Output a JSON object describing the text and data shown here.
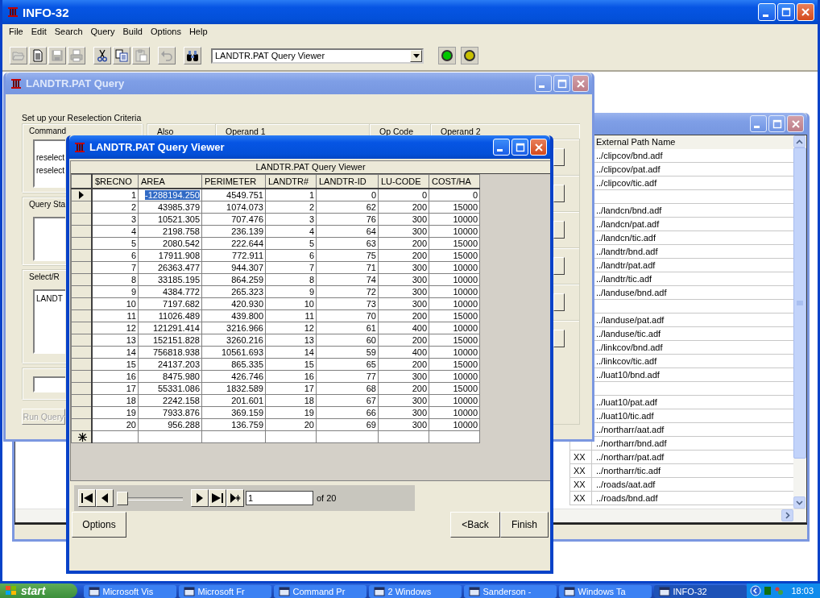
{
  "app_window": {
    "title": "INFO-32",
    "menu": [
      "File",
      "Edit",
      "Search",
      "Query",
      "Build",
      "Options",
      "Help"
    ],
    "toolbar": {
      "groups": [
        [
          {
            "kind": "open",
            "disabled": true
          },
          {
            "kind": "new",
            "disabled": false
          },
          {
            "kind": "save",
            "disabled": true
          },
          {
            "kind": "print",
            "disabled": true
          }
        ],
        [
          {
            "kind": "cut",
            "disabled": false
          },
          {
            "kind": "copy",
            "disabled": false
          },
          {
            "kind": "paste",
            "disabled": true
          }
        ],
        [
          {
            "kind": "undo",
            "disabled": true
          }
        ],
        [
          {
            "kind": "find",
            "disabled": false
          }
        ]
      ],
      "window_list": {
        "value": "LANDTR.PAT Query Viewer"
      },
      "lights": [
        {
          "color": "#00c800"
        },
        {
          "color": "#c8c000"
        }
      ]
    }
  },
  "files_window": {
    "column": "External Path Name",
    "rows": [
      {
        "kind": "file",
        "path": "../clipcov/bnd.adf"
      },
      {
        "kind": "file",
        "path": "../clipcov/pat.adf"
      },
      {
        "kind": "file",
        "path": "../clipcov/tic.adf"
      },
      {
        "kind": "blank"
      },
      {
        "kind": "file",
        "path": "../landcn/bnd.adf"
      },
      {
        "kind": "file",
        "path": "../landcn/pat.adf"
      },
      {
        "kind": "file",
        "path": "../landcn/tic.adf"
      },
      {
        "kind": "file",
        "path": "../landtr/bnd.adf"
      },
      {
        "kind": "file",
        "path": "../landtr/pat.adf"
      },
      {
        "kind": "file",
        "path": "../landtr/tic.adf"
      },
      {
        "kind": "file",
        "path": "../landuse/bnd.adf"
      },
      {
        "kind": "blank"
      },
      {
        "kind": "file",
        "path": "../landuse/pat.adf"
      },
      {
        "kind": "file",
        "path": "../landuse/tic.adf"
      },
      {
        "kind": "file",
        "path": "../linkcov/bnd.adf"
      },
      {
        "kind": "file",
        "path": "../linkcov/tic.adf"
      },
      {
        "kind": "file",
        "path": "../luat10/bnd.adf"
      },
      {
        "kind": "blank"
      },
      {
        "kind": "file",
        "path": "../luat10/pat.adf"
      },
      {
        "kind": "file",
        "path": "../luat10/tic.adf"
      },
      {
        "kind": "file",
        "path": "../northarr/aat.adf"
      },
      {
        "kind": "file",
        "path": "../northarr/bnd.adf"
      },
      {
        "kind": "file",
        "flag": "XX",
        "path": "../northarr/pat.adf"
      },
      {
        "kind": "file",
        "flag": "XX",
        "path": "../northarr/tic.adf"
      },
      {
        "kind": "file",
        "flag": "XX",
        "path": "../roads/aat.adf"
      },
      {
        "kind": "file",
        "flag": "XX",
        "path": "../roads/bnd.adf"
      }
    ]
  },
  "query_window": {
    "title": "LANDTR.PAT Query",
    "instructions": "Set up your Reselection Criteria",
    "command": {
      "label": "Command",
      "lines": [
        "reselect",
        "reselect"
      ]
    },
    "query_status": {
      "label": "Query Sta"
    },
    "select": {
      "label": "Select/R",
      "items": [
        "LANDT"
      ]
    },
    "run_button": {
      "label": "Run Query",
      "disabled": true
    },
    "criteria_columns": [
      "Also",
      "Operand 1",
      "Op Code",
      "Operand 2"
    ]
  },
  "viewer_window": {
    "title": "LANDTR.PAT Query Viewer",
    "grid": {
      "caption": "LANDTR.PAT Query Viewer",
      "columns": [
        "$RECNO",
        "AREA",
        "PERIMETER",
        "LANDTR#",
        "LANDTR-ID",
        "LU-CODE",
        "COST/HA"
      ],
      "rows": [
        {
          "current": true,
          "cells": [
            {
              "text": "1",
              "selected": false
            },
            {
              "text": "-1288194.250",
              "selected": true
            },
            {
              "text": "4549.751",
              "selected": false
            },
            {
              "text": "1",
              "selected": false
            },
            {
              "text": "0",
              "selected": false
            },
            {
              "text": "0",
              "selected": false
            },
            {
              "text": "0",
              "selected": false
            }
          ]
        },
        {
          "current": false,
          "cells": [
            {
              "text": "2",
              "selected": false
            },
            {
              "text": "43985.379",
              "selected": false
            },
            {
              "text": "1074.073",
              "selected": false
            },
            {
              "text": "2",
              "selected": false
            },
            {
              "text": "62",
              "selected": false
            },
            {
              "text": "200",
              "selected": false
            },
            {
              "text": "15000",
              "selected": false
            }
          ]
        },
        {
          "current": false,
          "cells": [
            {
              "text": "3",
              "selected": false
            },
            {
              "text": "10521.305",
              "selected": false
            },
            {
              "text": "707.476",
              "selected": false
            },
            {
              "text": "3",
              "selected": false
            },
            {
              "text": "76",
              "selected": false
            },
            {
              "text": "300",
              "selected": false
            },
            {
              "text": "10000",
              "selected": false
            }
          ]
        },
        {
          "current": false,
          "cells": [
            {
              "text": "4",
              "selected": false
            },
            {
              "text": "2198.758",
              "selected": false
            },
            {
              "text": "236.139",
              "selected": false
            },
            {
              "text": "4",
              "selected": false
            },
            {
              "text": "64",
              "selected": false
            },
            {
              "text": "300",
              "selected": false
            },
            {
              "text": "10000",
              "selected": false
            }
          ]
        },
        {
          "current": false,
          "cells": [
            {
              "text": "5",
              "selected": false
            },
            {
              "text": "2080.542",
              "selected": false
            },
            {
              "text": "222.644",
              "selected": false
            },
            {
              "text": "5",
              "selected": false
            },
            {
              "text": "63",
              "selected": false
            },
            {
              "text": "200",
              "selected": false
            },
            {
              "text": "15000",
              "selected": false
            }
          ]
        },
        {
          "current": false,
          "cells": [
            {
              "text": "6",
              "selected": false
            },
            {
              "text": "17911.908",
              "selected": false
            },
            {
              "text": "772.911",
              "selected": false
            },
            {
              "text": "6",
              "selected": false
            },
            {
              "text": "75",
              "selected": false
            },
            {
              "text": "200",
              "selected": false
            },
            {
              "text": "15000",
              "selected": false
            }
          ]
        },
        {
          "current": false,
          "cells": [
            {
              "text": "7",
              "selected": false
            },
            {
              "text": "26363.477",
              "selected": false
            },
            {
              "text": "944.307",
              "selected": false
            },
            {
              "text": "7",
              "selected": false
            },
            {
              "text": "71",
              "selected": false
            },
            {
              "text": "300",
              "selected": false
            },
            {
              "text": "10000",
              "selected": false
            }
          ]
        },
        {
          "current": false,
          "cells": [
            {
              "text": "8",
              "selected": false
            },
            {
              "text": "33185.195",
              "selected": false
            },
            {
              "text": "864.259",
              "selected": false
            },
            {
              "text": "8",
              "selected": false
            },
            {
              "text": "74",
              "selected": false
            },
            {
              "text": "300",
              "selected": false
            },
            {
              "text": "10000",
              "selected": false
            }
          ]
        },
        {
          "current": false,
          "cells": [
            {
              "text": "9",
              "selected": false
            },
            {
              "text": "4384.772",
              "selected": false
            },
            {
              "text": "265.323",
              "selected": false
            },
            {
              "text": "9",
              "selected": false
            },
            {
              "text": "72",
              "selected": false
            },
            {
              "text": "300",
              "selected": false
            },
            {
              "text": "10000",
              "selected": false
            }
          ]
        },
        {
          "current": false,
          "cells": [
            {
              "text": "10",
              "selected": false
            },
            {
              "text": "7197.682",
              "selected": false
            },
            {
              "text": "420.930",
              "selected": false
            },
            {
              "text": "10",
              "selected": false
            },
            {
              "text": "73",
              "selected": false
            },
            {
              "text": "300",
              "selected": false
            },
            {
              "text": "10000",
              "selected": false
            }
          ]
        },
        {
          "current": false,
          "cells": [
            {
              "text": "11",
              "selected": false
            },
            {
              "text": "11026.489",
              "selected": false
            },
            {
              "text": "439.800",
              "selected": false
            },
            {
              "text": "11",
              "selected": false
            },
            {
              "text": "70",
              "selected": false
            },
            {
              "text": "200",
              "selected": false
            },
            {
              "text": "15000",
              "selected": false
            }
          ]
        },
        {
          "current": false,
          "cells": [
            {
              "text": "12",
              "selected": false
            },
            {
              "text": "121291.414",
              "selected": false
            },
            {
              "text": "3216.966",
              "selected": false
            },
            {
              "text": "12",
              "selected": false
            },
            {
              "text": "61",
              "selected": false
            },
            {
              "text": "400",
              "selected": false
            },
            {
              "text": "10000",
              "selected": false
            }
          ]
        },
        {
          "current": false,
          "cells": [
            {
              "text": "13",
              "selected": false
            },
            {
              "text": "152151.828",
              "selected": false
            },
            {
              "text": "3260.216",
              "selected": false
            },
            {
              "text": "13",
              "selected": false
            },
            {
              "text": "60",
              "selected": false
            },
            {
              "text": "200",
              "selected": false
            },
            {
              "text": "15000",
              "selected": false
            }
          ]
        },
        {
          "current": false,
          "cells": [
            {
              "text": "14",
              "selected": false
            },
            {
              "text": "756818.938",
              "selected": false
            },
            {
              "text": "10561.693",
              "selected": false
            },
            {
              "text": "14",
              "selected": false
            },
            {
              "text": "59",
              "selected": false
            },
            {
              "text": "400",
              "selected": false
            },
            {
              "text": "10000",
              "selected": false
            }
          ]
        },
        {
          "current": false,
          "cells": [
            {
              "text": "15",
              "selected": false
            },
            {
              "text": "24137.203",
              "selected": false
            },
            {
              "text": "865.335",
              "selected": false
            },
            {
              "text": "15",
              "selected": false
            },
            {
              "text": "65",
              "selected": false
            },
            {
              "text": "200",
              "selected": false
            },
            {
              "text": "15000",
              "selected": false
            }
          ]
        },
        {
          "current": false,
          "cells": [
            {
              "text": "16",
              "selected": false
            },
            {
              "text": "8475.980",
              "selected": false
            },
            {
              "text": "426.746",
              "selected": false
            },
            {
              "text": "16",
              "selected": false
            },
            {
              "text": "77",
              "selected": false
            },
            {
              "text": "300",
              "selected": false
            },
            {
              "text": "10000",
              "selected": false
            }
          ]
        },
        {
          "current": false,
          "cells": [
            {
              "text": "17",
              "selected": false
            },
            {
              "text": "55331.086",
              "selected": false
            },
            {
              "text": "1832.589",
              "selected": false
            },
            {
              "text": "17",
              "selected": false
            },
            {
              "text": "68",
              "selected": false
            },
            {
              "text": "200",
              "selected": false
            },
            {
              "text": "15000",
              "selected": false
            }
          ]
        },
        {
          "current": false,
          "cells": [
            {
              "text": "18",
              "selected": false
            },
            {
              "text": "2242.158",
              "selected": false
            },
            {
              "text": "201.601",
              "selected": false
            },
            {
              "text": "18",
              "selected": false
            },
            {
              "text": "67",
              "selected": false
            },
            {
              "text": "300",
              "selected": false
            },
            {
              "text": "10000",
              "selected": false
            }
          ]
        },
        {
          "current": false,
          "cells": [
            {
              "text": "19",
              "selected": false
            },
            {
              "text": "7933.876",
              "selected": false
            },
            {
              "text": "369.159",
              "selected": false
            },
            {
              "text": "19",
              "selected": false
            },
            {
              "text": "66",
              "selected": false
            },
            {
              "text": "300",
              "selected": false
            },
            {
              "text": "10000",
              "selected": false
            }
          ]
        },
        {
          "current": false,
          "cells": [
            {
              "text": "20",
              "selected": false
            },
            {
              "text": "956.288",
              "selected": false
            },
            {
              "text": "136.759",
              "selected": false
            },
            {
              "text": "20",
              "selected": false
            },
            {
              "text": "69",
              "selected": false
            },
            {
              "text": "300",
              "selected": false
            },
            {
              "text": "10000",
              "selected": false
            }
          ]
        }
      ]
    },
    "navigator": {
      "record": "1",
      "count": "of 20",
      "level": 0
    },
    "buttons": [
      {
        "kind": "options",
        "label": "Options"
      },
      {
        "kind": "back",
        "label": "<Back"
      },
      {
        "kind": "finish",
        "label": "Finish"
      }
    ]
  },
  "taskbar": {
    "start": "start",
    "tasks": [
      {
        "label": "Microsoft Vis",
        "selected": false
      },
      {
        "label": "Microsoft Fr",
        "selected": false
      },
      {
        "label": "Command Pr",
        "selected": false
      },
      {
        "label": "2 Windows",
        "selected": false
      },
      {
        "label": "Sanderson -",
        "selected": false
      },
      {
        "label": "Windows Ta",
        "selected": false
      },
      {
        "label": "INFO-32",
        "selected": true
      }
    ],
    "clock": "18:03"
  }
}
